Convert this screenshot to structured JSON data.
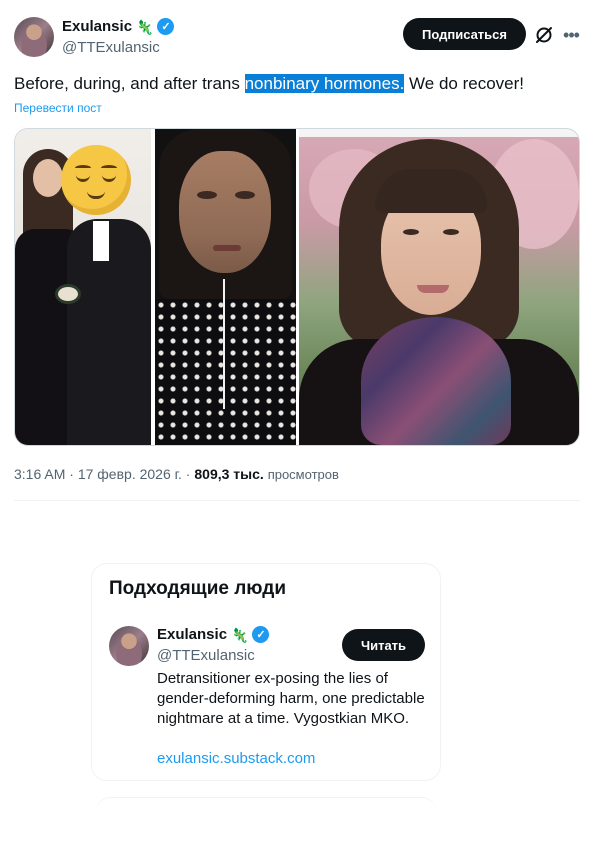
{
  "post": {
    "author": {
      "display_name": "Exulansic",
      "handle": "@TTExulansic",
      "emoji": "🦎",
      "verified": "✓"
    },
    "subscribe_label": "Подписаться",
    "more_label": "•••",
    "text_before": "Before, during, and after trans ",
    "text_highlight": "nonbinary hormones.",
    "text_after": " We do recover!",
    "translate_label": "Перевести пост",
    "meta": {
      "time": "3:16 AM",
      "separator": " · ",
      "date": "17 февр. 2026 г.",
      "views_count": "809,3 тыс.",
      "views_label": "просмотров"
    }
  },
  "suggested": {
    "title": "Подходящие люди",
    "person": {
      "display_name": "Exulansic",
      "emoji": "🦎",
      "verified": "✓",
      "handle": "@TTExulansic",
      "follow_label": "Читать",
      "bio": "Detransitioner ex-posing the lies of gender-deforming harm, one predictable nightmare at a time. Vygostkian MKO.",
      "link": "exulansic.substack.com"
    }
  },
  "colors": {
    "accent": "#1d9bf0",
    "text": "#0f1419",
    "secondary": "#536471",
    "button_dark": "#0f1419",
    "highlight": "#0a7fd7"
  },
  "icons": [
    "verified-badge-icon",
    "grok-icon",
    "more-icon",
    "lizard-emoji"
  ]
}
